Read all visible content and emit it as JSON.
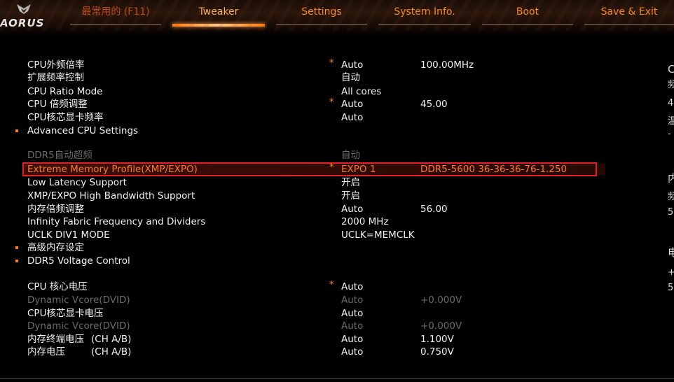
{
  "header": {
    "logo_text": "AORUS",
    "tabs": [
      {
        "label": "最常用的 (F11)",
        "active": false
      },
      {
        "label": "Tweaker",
        "active": true
      },
      {
        "label": "Settings",
        "active": false
      },
      {
        "label": "System Info.",
        "active": false
      },
      {
        "label": "Boot",
        "active": false
      },
      {
        "label": "Save & Exit",
        "active": false
      }
    ]
  },
  "rows": [
    {
      "label": "CPU外频倍率",
      "star": "*",
      "value": "Auto",
      "value2": "100.00MHz"
    },
    {
      "label": "扩展频率控制",
      "value": "自动"
    },
    {
      "label": "CPU Ratio Mode",
      "value": "All cores"
    },
    {
      "label": "CPU 倍频调整",
      "star": "*",
      "value": "Auto",
      "value2": "45.00"
    },
    {
      "label": "CPU核芯显卡频率",
      "value": "Auto"
    },
    {
      "label": "Advanced CPU Settings"
    },
    {
      "label": "DDR5自动超频",
      "value": "自动"
    },
    {
      "label": "Extreme Memory Profile(XMP/EXPO)",
      "star": "*",
      "value": "EXPO 1",
      "value2": "DDR5-5600 36-36-36-76-1.250"
    },
    {
      "label": "Low Latency Support",
      "value": "开启"
    },
    {
      "label": "XMP/EXPO High Bandwidth Support",
      "value": "开启"
    },
    {
      "label": "内存倍频调整",
      "value": "Auto",
      "value2": "56.00"
    },
    {
      "label": "Infinity Fabric Frequency and Dividers",
      "value": "2000 MHz"
    },
    {
      "label": "UCLK DIV1 MODE",
      "value": "UCLK=MEMCLK"
    },
    {
      "label": "高级内存设定"
    },
    {
      "label": "DDR5 Voltage Control"
    },
    {
      "label": "CPU 核心电压",
      "star": "*",
      "value": "Auto"
    },
    {
      "label": "Dynamic Vcore(DVID)",
      "value": "Auto",
      "value2": "+0.000V"
    },
    {
      "label": "CPU核芯显卡电压",
      "value": "Auto"
    },
    {
      "label": "Dynamic Vcore(DVID)",
      "value": "Auto",
      "value2": "+0.000V"
    },
    {
      "label": "内存终端电压",
      "label2": "(CH A/B)",
      "value": "Auto",
      "value2": "1.100V"
    },
    {
      "label": "内存电压",
      "label2": "(CH A/B)",
      "value": "Auto",
      "value2": "0.750V"
    }
  ],
  "right_strip": [
    "C",
    "频",
    "4",
    "温",
    "-",
    "内",
    "频",
    "5",
    "电",
    "+",
    "5"
  ],
  "colors": {
    "accent": "#ff7a10",
    "selection_border": "#e0212a",
    "dim_text": "#6b6b6b"
  }
}
